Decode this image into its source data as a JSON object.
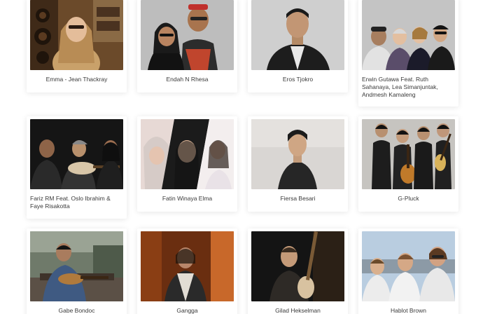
{
  "artists": [
    {
      "name": "Emma - Jean Thackray"
    },
    {
      "name": "Endah N Rhesa"
    },
    {
      "name": "Eros Tjokro"
    },
    {
      "name": "Erwin Gutawa Feat. Ruth Sahanaya, Lea Simanjuntak, Andmesh Kamaleng"
    },
    {
      "name": "Fariz RM Feat. Oslo Ibrahim & Faye Risakotta"
    },
    {
      "name": "Fatin Winaya Elma"
    },
    {
      "name": "Fiersa Besari"
    },
    {
      "name": "G-Pluck"
    },
    {
      "name": "Gabe Bondoc"
    },
    {
      "name": "Gangga"
    },
    {
      "name": "Gilad Hekselman"
    },
    {
      "name": "Hablot Brown"
    }
  ]
}
